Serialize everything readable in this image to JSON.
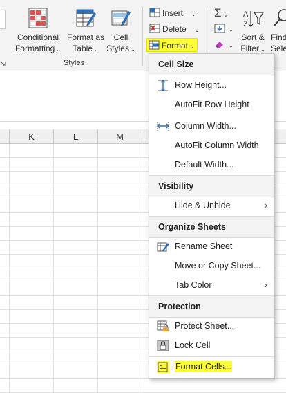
{
  "ribbon": {
    "conditional_formatting": {
      "line1": "Conditional",
      "line2": "Formatting"
    },
    "format_as_table": {
      "line1": "Format as",
      "line2": "Table"
    },
    "cell_styles": {
      "line1": "Cell",
      "line2": "Styles"
    },
    "styles_group_label": "Styles",
    "insert_label": "Insert",
    "delete_label": "Delete",
    "format_label": "Format",
    "sort_filter": {
      "line1": "Sort &",
      "line2": "Filter"
    },
    "find_select": {
      "line1": "Find",
      "line2": "Selec"
    },
    "format_highlight_color": "#ffff37"
  },
  "columns": [
    "K",
    "L",
    "M"
  ],
  "menu": {
    "cell_size_header": "Cell Size",
    "row_height": "Row Height...",
    "autofit_row_height": "AutoFit Row Height",
    "column_width": "Column Width...",
    "autofit_column_width": "AutoFit Column Width",
    "default_width": "Default Width...",
    "visibility_header": "Visibility",
    "hide_unhide": "Hide & Unhide",
    "organize_sheets_header": "Organize Sheets",
    "rename_sheet": "Rename Sheet",
    "move_copy_sheet": "Move or Copy Sheet...",
    "tab_color": "Tab Color",
    "protection_header": "Protection",
    "protect_sheet": "Protect Sheet...",
    "lock_cell": "Lock Cell",
    "format_cells": "Format Cells..."
  }
}
